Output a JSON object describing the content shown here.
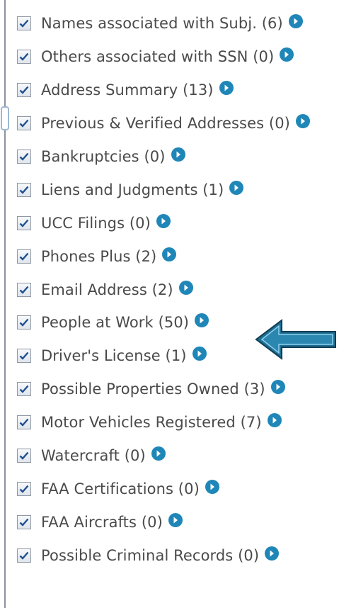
{
  "items": [
    {
      "label": "Names associated with Subj. (6)",
      "checked": true
    },
    {
      "label": "Others associated with SSN (0)",
      "checked": true
    },
    {
      "label": "Address Summary (13)",
      "checked": true
    },
    {
      "label": "Previous & Verified Addresses (0)",
      "checked": true
    },
    {
      "label": "Bankruptcies (0)",
      "checked": true
    },
    {
      "label": "Liens and Judgments (1)",
      "checked": true
    },
    {
      "label": "UCC Filings (0)",
      "checked": true
    },
    {
      "label": "Phones Plus (2)",
      "checked": true
    },
    {
      "label": "Email Address (2)",
      "checked": true
    },
    {
      "label": "People at Work (50)",
      "checked": true
    },
    {
      "label": "Driver's License (1)",
      "checked": true
    },
    {
      "label": "Possible Properties Owned (3)",
      "checked": true
    },
    {
      "label": "Motor Vehicles Registered (7)",
      "checked": true
    },
    {
      "label": "Watercraft (0)",
      "checked": true
    },
    {
      "label": "FAA Certifications (0)",
      "checked": true
    },
    {
      "label": "FAA Aircrafts (0)",
      "checked": true
    },
    {
      "label": "Possible Criminal Records (0)",
      "checked": true
    }
  ],
  "colors": {
    "go_button": "#1f86b8",
    "arrow_fill": "#1f6e92",
    "check_mark": "#1f4f8f"
  },
  "icons": {
    "checkbox": "checkbox-checked-icon",
    "go": "go-arrow-icon",
    "pointer": "left-arrow-icon"
  }
}
